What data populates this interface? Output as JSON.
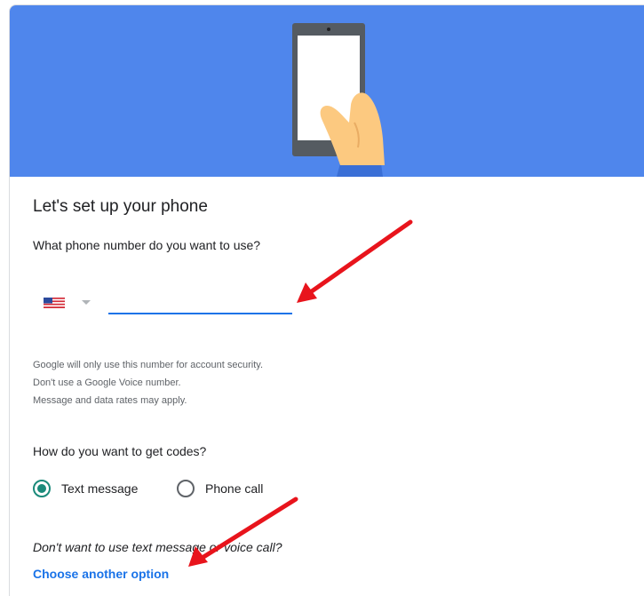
{
  "setup": {
    "title": "Let's set up your phone",
    "question": "What phone number do you want to use?",
    "country": {
      "selected_flag": "us-flag-icon"
    },
    "phone_input": {
      "value": "",
      "placeholder": ""
    },
    "fineprint": [
      "Google will only use this number for account security.",
      "Don't use a Google Voice number.",
      "Message and data rates may apply."
    ],
    "codes_question": "How do you want to get codes?",
    "code_options": [
      {
        "label": "Text message",
        "selected": true
      },
      {
        "label": "Phone call",
        "selected": false
      }
    ],
    "alt_question": "Don't want to use text message or voice call?",
    "alt_link": "Choose another option"
  },
  "colors": {
    "hero_bg": "#4f86ec",
    "input_focus": "#1a73e8",
    "radio_selected": "#1a8a7a",
    "link": "#1a73e8",
    "annotation_arrow": "#e8141c"
  }
}
